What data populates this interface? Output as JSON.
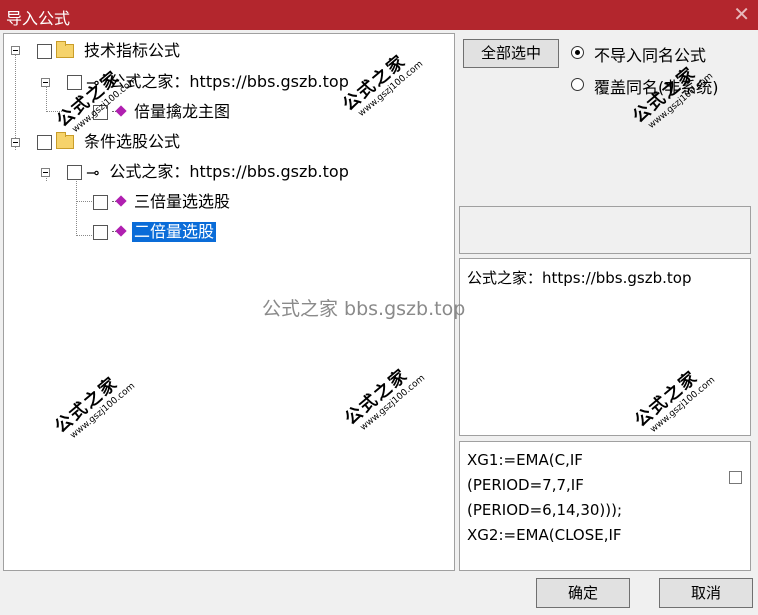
{
  "window": {
    "title": "导入公式",
    "close_glyph": "✕"
  },
  "tree": {
    "nodes": [
      {
        "label": "技术指标公式",
        "type": "folder"
      },
      {
        "label": "公式之家：https://bbs.gszb.top",
        "type": "key"
      },
      {
        "label": "倍量擒龙主图",
        "type": "formula"
      },
      {
        "label": "条件选股公式",
        "type": "folder"
      },
      {
        "label": "公式之家：https://bbs.gszb.top",
        "type": "key"
      },
      {
        "label": "三倍量选选股",
        "type": "formula"
      },
      {
        "label": "二倍量选股",
        "type": "formula",
        "selected": true
      }
    ]
  },
  "options": {
    "select_all_label": "全部选中",
    "radios": [
      {
        "label": "不导入同名公式",
        "checked": true
      },
      {
        "label": "覆盖同名(非系统)",
        "checked": false
      }
    ]
  },
  "description": "公式之家：https://bbs.gszb.top",
  "code": "XG1:=EMA(C,IF\n(PERIOD=7,7,IF\n(PERIOD=6,14,30)));\nXG2:=EMA(CLOSE,IF",
  "watermark": {
    "site_big": "公式之家",
    "site_small": "www.gszj100.com",
    "center": "公式之家 bbs.gszb.top"
  },
  "buttons": {
    "ok": "确定",
    "cancel": "取消"
  },
  "colors": {
    "titlebar": "#b3262d",
    "selection": "#0a6cd8"
  }
}
